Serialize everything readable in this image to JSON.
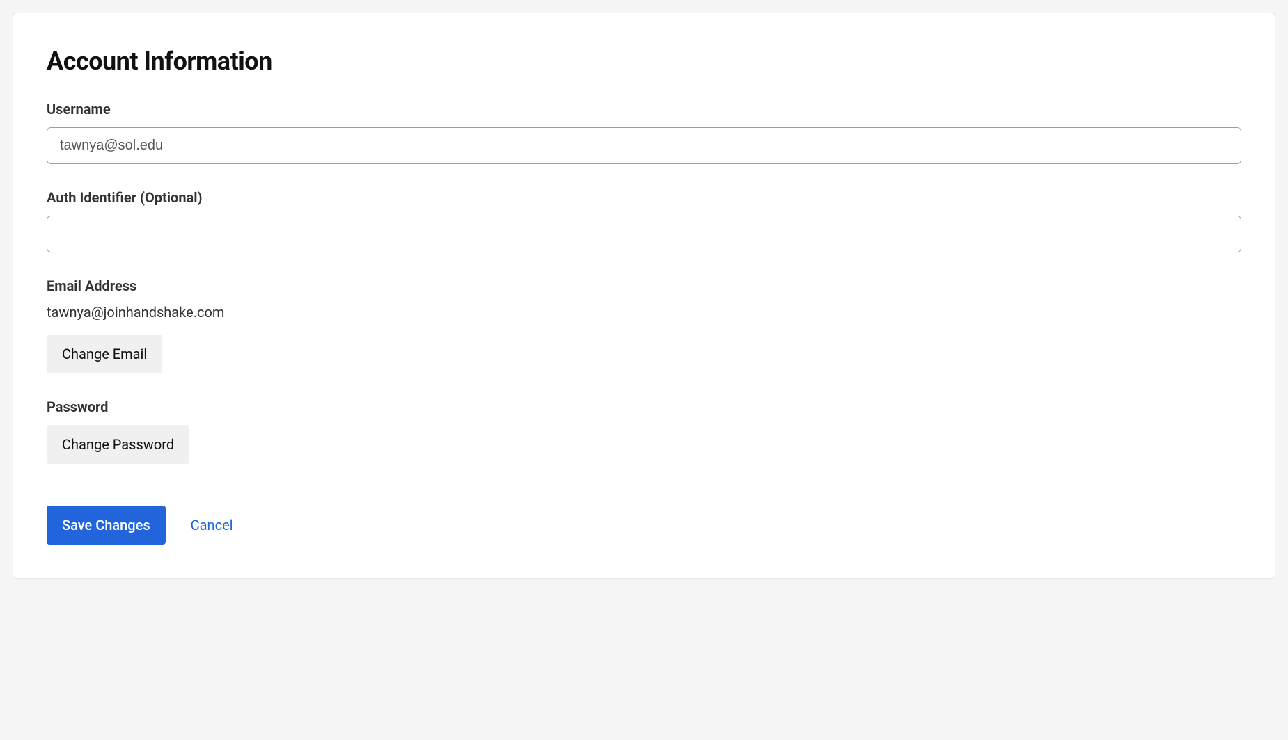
{
  "page": {
    "title": "Account Information"
  },
  "fields": {
    "username": {
      "label": "Username",
      "value": "tawnya@sol.edu"
    },
    "auth_identifier": {
      "label": "Auth Identifier (Optional)",
      "value": ""
    },
    "email": {
      "label": "Email Address",
      "value": "tawnya@joinhandshake.com",
      "change_button": "Change Email"
    },
    "password": {
      "label": "Password",
      "change_button": "Change Password"
    }
  },
  "actions": {
    "save": "Save Changes",
    "cancel": "Cancel"
  }
}
